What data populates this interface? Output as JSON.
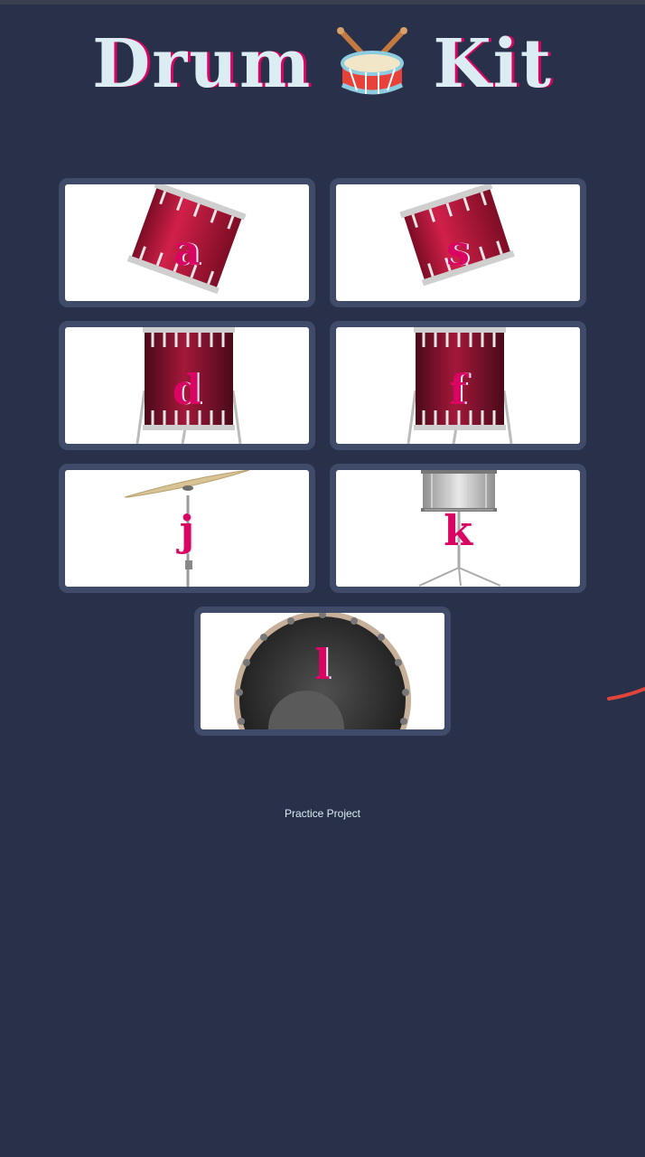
{
  "header": {
    "title_left": "Drum",
    "title_icon": "drum-icon",
    "title_right": "Kit"
  },
  "drums": [
    {
      "key": "a",
      "instrument": "tom-1"
    },
    {
      "key": "s",
      "instrument": "tom-2"
    },
    {
      "key": "d",
      "instrument": "tom-3"
    },
    {
      "key": "f",
      "instrument": "tom-4"
    },
    {
      "key": "j",
      "instrument": "crash-cymbal"
    },
    {
      "key": "k",
      "instrument": "snare"
    },
    {
      "key": "l",
      "instrument": "kick-bass"
    }
  ],
  "footer": {
    "text": "Practice Project"
  },
  "colors": {
    "background": "#283149",
    "accent": "#da0463",
    "text": "#dbedf3",
    "button_border": "#404b69"
  }
}
